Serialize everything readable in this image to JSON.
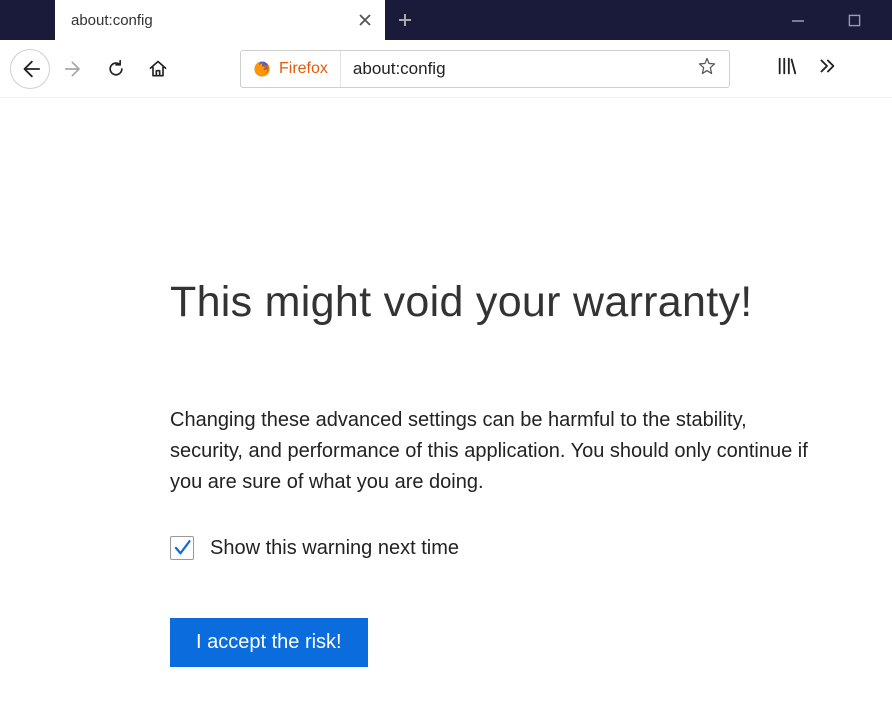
{
  "tab": {
    "title": "about:config"
  },
  "address": {
    "identity_label": "Firefox",
    "url": "about:config"
  },
  "warning": {
    "headline": "This might void your warranty!",
    "body": "Changing these advanced settings can be harmful to the stability, security, and performance of this application. You should only continue if you are sure of what you are doing.",
    "checkbox_label": "Show this warning next time",
    "accept_label": "I accept the risk!",
    "checkbox_checked": true
  },
  "colors": {
    "chrome_dark": "#1a1b3a",
    "identity_orange": "#e25b0e",
    "accept_blue": "#0a6cdd",
    "check_blue": "#0a6cdd"
  }
}
